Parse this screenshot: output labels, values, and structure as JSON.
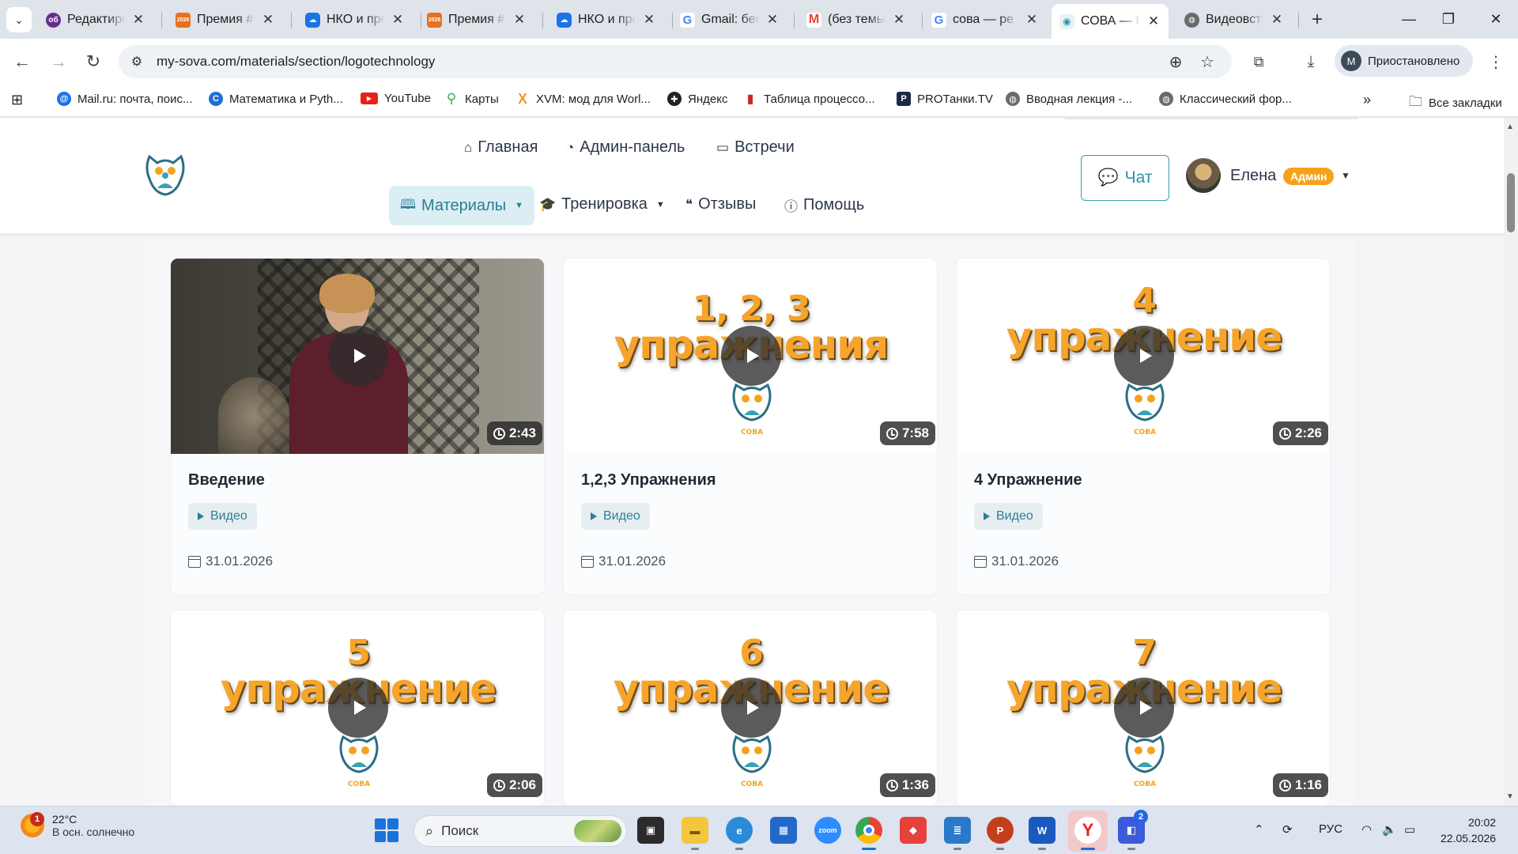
{
  "browser": {
    "tabs": [
      {
        "title": "Редактиро",
        "favicon": "ob",
        "color": "#6a2d8c"
      },
      {
        "title": "Премия #",
        "favicon": "2026",
        "color": "#e8711c"
      },
      {
        "title": "НКО и пре",
        "favicon": "cloud",
        "color": "#1a73e8"
      },
      {
        "title": "Премия #",
        "favicon": "2026",
        "color": "#e8711c"
      },
      {
        "title": "НКО и про",
        "favicon": "cloud",
        "color": "#1a73e8"
      },
      {
        "title": "Gmail: бес",
        "favicon": "G",
        "color": "#4285f4"
      },
      {
        "title": "(без темы)",
        "favicon": "M",
        "color": "#ea4335"
      },
      {
        "title": "сова — ре",
        "favicon": "G",
        "color": "#4285f4"
      },
      {
        "title": "СОВА — П",
        "favicon": "owl",
        "color": "#2a93aa",
        "active": true
      },
      {
        "title": "Видеовстр",
        "favicon": "globe",
        "color": "#555555"
      }
    ],
    "url": "my-sova.com/materials/section/logotechnology",
    "profile_label": "Приостановлено",
    "profile_initial": "M",
    "bookmarks": [
      {
        "label": "Mail.ru: почта, поис...",
        "icon": "@",
        "color": "#1a73e8"
      },
      {
        "label": "Математика и Pyth...",
        "icon": "C",
        "color": "#1f6fd6"
      },
      {
        "label": "YouTube",
        "icon": "▶",
        "color": "#e62117"
      },
      {
        "label": "Карты",
        "icon": "map-pin",
        "color": "#34a853"
      },
      {
        "label": "XVM: мод для Worl...",
        "icon": "X",
        "color": "#f29a2e"
      },
      {
        "label": "Яндекс",
        "icon": "✚",
        "color": "#222222"
      },
      {
        "label": "Таблица процессо...",
        "icon": "bar",
        "color": "#c62828"
      },
      {
        "label": "PROТанки.TV",
        "icon": "P",
        "color": "#1b2a4a"
      },
      {
        "label": "Вводная лекция -...",
        "icon": "globe",
        "color": "#555555"
      },
      {
        "label": "Классический фор...",
        "icon": "globe",
        "color": "#555555"
      }
    ],
    "all_bookmarks_label": "Все закладки"
  },
  "site": {
    "nav_top": [
      {
        "label": "Главная",
        "icon": "home-icon"
      },
      {
        "label": "Админ-панель",
        "icon": "gauge-icon"
      },
      {
        "label": "Встречи",
        "icon": "video-icon"
      }
    ],
    "nav_bottom": [
      {
        "label": "Материалы",
        "icon": "book-icon",
        "active": true,
        "dropdown": true
      },
      {
        "label": "Тренировка",
        "icon": "graduation-cap-icon",
        "dropdown": true
      },
      {
        "label": "Отзывы",
        "icon": "quote-icon"
      },
      {
        "label": "Помощь",
        "icon": "question-icon"
      }
    ],
    "chat_label": "Чат",
    "user_name": "Елена",
    "user_role": "Админ",
    "accent_color": "#2a93aa",
    "badge_color": "#f5a21b"
  },
  "cards": [
    {
      "title": "Введение",
      "duration": "2:43",
      "type": "Видео",
      "date": "31.01.2026",
      "thumb": "photo"
    },
    {
      "title": "1,2,3 Упражнения",
      "duration": "7:58",
      "type": "Видео",
      "date": "31.01.2026",
      "thumb_line1": "1, 2, 3",
      "thumb_line2": "упражнения"
    },
    {
      "title": "4 Упражнение",
      "duration": "2:26",
      "type": "Видео",
      "date": "31.01.2026",
      "thumb_line1": "4",
      "thumb_line2": "упражнение"
    },
    {
      "title": "",
      "duration": "2:06",
      "thumb_line1": "5",
      "thumb_line2": "упражнение"
    },
    {
      "title": "",
      "duration": "1:36",
      "thumb_line1": "6",
      "thumb_line2": "упражнение"
    },
    {
      "title": "",
      "duration": "1:16",
      "thumb_line1": "7",
      "thumb_line2": "упражнение"
    }
  ],
  "thumb_logo_text": "СОВА",
  "taskbar": {
    "temp": "22°C",
    "weather": "В осн. солнечно",
    "notification_count": "1",
    "search_placeholder": "Поиск",
    "lang": "РУС",
    "time": "20:02",
    "date": "22.05.2026",
    "zoom_label": "zoom",
    "badge_count": "2"
  }
}
